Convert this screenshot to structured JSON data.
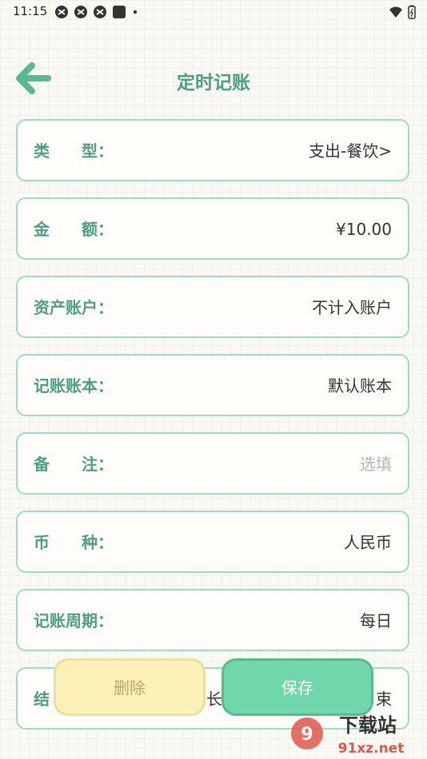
{
  "status_bar": {
    "time": "11:15"
  },
  "header": {
    "title": "定时记账"
  },
  "form": {
    "rows": [
      {
        "label": "类　　型：",
        "value": "支出-餐饮>"
      },
      {
        "label": "金　　额：",
        "value": "¥10.00"
      },
      {
        "label": "资产账户：",
        "value": "不计入账户"
      },
      {
        "label": "记账账本：",
        "value": "默认账本"
      },
      {
        "label": "备　　注：",
        "value": "选填",
        "placeholder": true
      },
      {
        "label": "币　　种：",
        "value": "人民币"
      },
      {
        "label": "记账周期：",
        "value": "每日"
      },
      {
        "label": "结",
        "value": "束",
        "middle": "长"
      }
    ]
  },
  "actions": {
    "delete_label": "删除",
    "save_label": "保存"
  },
  "watermark": {
    "text_top": "下载站",
    "text_bottom": "91xz.net"
  },
  "colors": {
    "accent": "#4d9e82",
    "border": "#9fdcc3",
    "save": "#6fd7a9",
    "delete": "#fbf1b8"
  }
}
